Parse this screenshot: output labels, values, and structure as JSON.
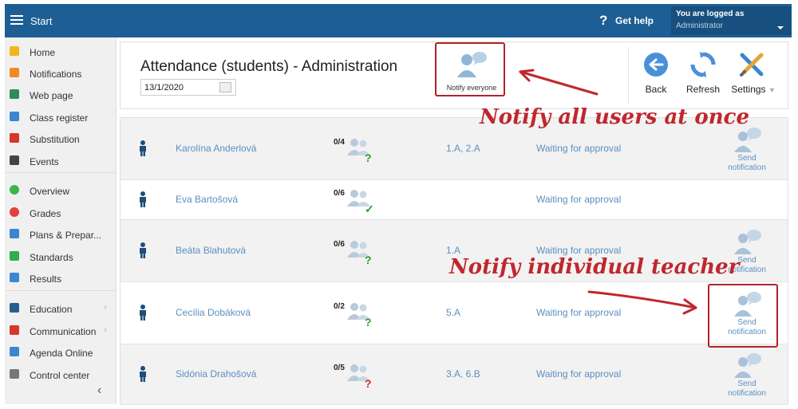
{
  "topbar": {
    "start_label": "Start",
    "help_label": "Get help",
    "logged_line1": "You are logged as",
    "logged_line2": "Administrator"
  },
  "sidebar": {
    "items": [
      {
        "label": "Home",
        "icon": "star-icon",
        "color": "#f2b51c"
      },
      {
        "label": "Notifications",
        "icon": "envelope-icon",
        "color": "#f08a24"
      },
      {
        "label": "Web page",
        "icon": "home-icon",
        "color": "#2e8b57"
      },
      {
        "label": "Class register",
        "icon": "book-icon",
        "color": "#3a86d0"
      },
      {
        "label": "Substitution",
        "icon": "substitution-icon",
        "color": "#d9352b"
      },
      {
        "label": "Events",
        "icon": "calendar-icon",
        "color": "#444444"
      },
      {
        "label": "Overview",
        "icon": "check-circle-icon",
        "color": "#3cb44b"
      },
      {
        "label": "Grades",
        "icon": "grades-icon",
        "color": "#e0413c"
      },
      {
        "label": "Plans & Prepar...",
        "icon": "briefcase-icon",
        "color": "#3a86d0"
      },
      {
        "label": "Standards",
        "icon": "shield-icon",
        "color": "#2eae4c"
      },
      {
        "label": "Results",
        "icon": "bar-chart-icon",
        "color": "#3a86d0"
      },
      {
        "label": "Education",
        "icon": "education-icon",
        "color": "#2a5d8f"
      },
      {
        "label": "Communication",
        "icon": "chat-icon",
        "color": "#d9352b"
      },
      {
        "label": "Agenda Online",
        "icon": "pencil-icon",
        "color": "#3a86d0"
      },
      {
        "label": "Control center",
        "icon": "gear-icon",
        "color": "#777777"
      }
    ],
    "collapse_glyph": "‹"
  },
  "header": {
    "title": "Attendance (students) - Administration",
    "date": "13/1/2020",
    "notify_everyone_label": "Notify everyone",
    "back_label": "Back",
    "refresh_label": "Refresh",
    "settings_label": "Settings"
  },
  "rows": [
    {
      "name": "Karolína Anderlová",
      "count": "0/4",
      "mark": "?",
      "mark_color": "#2a9d2a",
      "classes": "1.A, 2.A",
      "status": "Waiting for approval",
      "send": true
    },
    {
      "name": "Eva Bartošová",
      "count": "0/6",
      "mark": "✓",
      "mark_color": "#2a9d2a",
      "classes": "",
      "status": "Waiting for approval",
      "send": false
    },
    {
      "name": "Beáta Blahutová",
      "count": "0/6",
      "mark": "?",
      "mark_color": "#2a9d2a",
      "classes": "1.A",
      "status": "Waiting for approval",
      "send": true
    },
    {
      "name": "Cecília Dobáková",
      "count": "0/2",
      "mark": "?",
      "mark_color": "#2a9d2a",
      "classes": "5.A",
      "status": "Waiting for approval",
      "send": true
    },
    {
      "name": "Sidónia Drahošová",
      "count": "0/5",
      "mark": "?",
      "mark_color": "#d9262c",
      "classes": "3.A, 6.B",
      "status": "Waiting for approval",
      "send": true
    }
  ],
  "send_line1": "Send",
  "send_line2": "notification",
  "annotations": {
    "notify_all": "Notify all users at once",
    "notify_individual": "Notify individual teacher"
  },
  "colors": {
    "topbar": "#1d5e95",
    "link": "#5b8fbf",
    "annotation_red": "#c0272d"
  }
}
